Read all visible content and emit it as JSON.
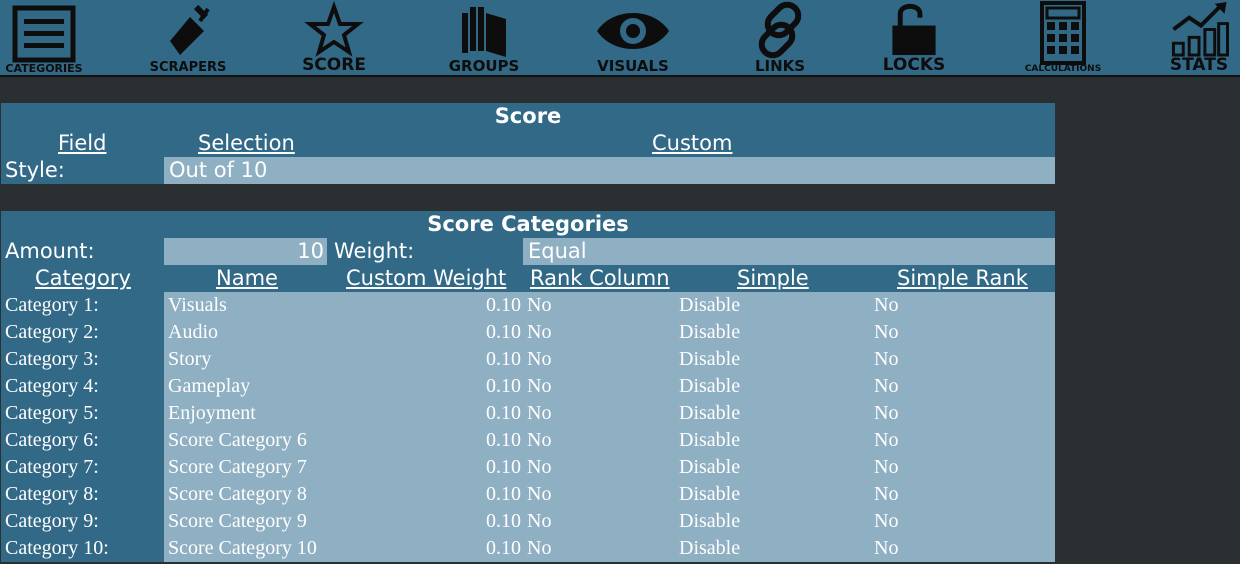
{
  "toolbar": {
    "categories": "CATEGORIES",
    "scrapers": "SCRAPERS",
    "score": "SCORE",
    "groups": "GROUPS",
    "visuals": "VISUALS",
    "links": "LINKS",
    "locks": "LOCKS",
    "calculations": "CALCULATIONS",
    "stats": "STATS"
  },
  "score_panel": {
    "title": "Score",
    "headers": {
      "field": "Field",
      "selection": "Selection",
      "custom": "Custom"
    },
    "style_label": "Style:",
    "style_value": "Out of 10"
  },
  "categories_panel": {
    "title": "Score Categories",
    "amount_label": "Amount:",
    "amount_value": "10",
    "weight_label": "Weight:",
    "weight_value": "Equal",
    "headers": {
      "category": "Category",
      "name": "Name",
      "custom_weight": "Custom Weight",
      "rank_column": "Rank Column",
      "simple": "Simple",
      "simple_rank": "Simple Rank"
    },
    "rows": [
      {
        "label": "Category 1:",
        "name": "Visuals",
        "weight": "0.10",
        "rank": "No",
        "simple": "Disable",
        "simple_rank": "No"
      },
      {
        "label": "Category 2:",
        "name": "Audio",
        "weight": "0.10",
        "rank": "No",
        "simple": "Disable",
        "simple_rank": "No"
      },
      {
        "label": "Category 3:",
        "name": "Story",
        "weight": "0.10",
        "rank": "No",
        "simple": "Disable",
        "simple_rank": "No"
      },
      {
        "label": "Category 4:",
        "name": "Gameplay",
        "weight": "0.10",
        "rank": "No",
        "simple": "Disable",
        "simple_rank": "No"
      },
      {
        "label": "Category 5:",
        "name": "Enjoyment",
        "weight": "0.10",
        "rank": "No",
        "simple": "Disable",
        "simple_rank": "No"
      },
      {
        "label": "Category 6:",
        "name": "Score Category 6",
        "weight": "0.10",
        "rank": "No",
        "simple": "Disable",
        "simple_rank": "No"
      },
      {
        "label": "Category 7:",
        "name": "Score Category 7",
        "weight": "0.10",
        "rank": "No",
        "simple": "Disable",
        "simple_rank": "No"
      },
      {
        "label": "Category 8:",
        "name": "Score Category 8",
        "weight": "0.10",
        "rank": "No",
        "simple": "Disable",
        "simple_rank": "No"
      },
      {
        "label": "Category 9:",
        "name": "Score Category 9",
        "weight": "0.10",
        "rank": "No",
        "simple": "Disable",
        "simple_rank": "No"
      },
      {
        "label": "Category 10:",
        "name": "Score Category 10",
        "weight": "0.10",
        "rank": "No",
        "simple": "Disable",
        "simple_rank": "No"
      }
    ]
  },
  "colors": {
    "panel": "#326986",
    "input_fill": "#8fafc3",
    "background": "#2a2f32"
  }
}
